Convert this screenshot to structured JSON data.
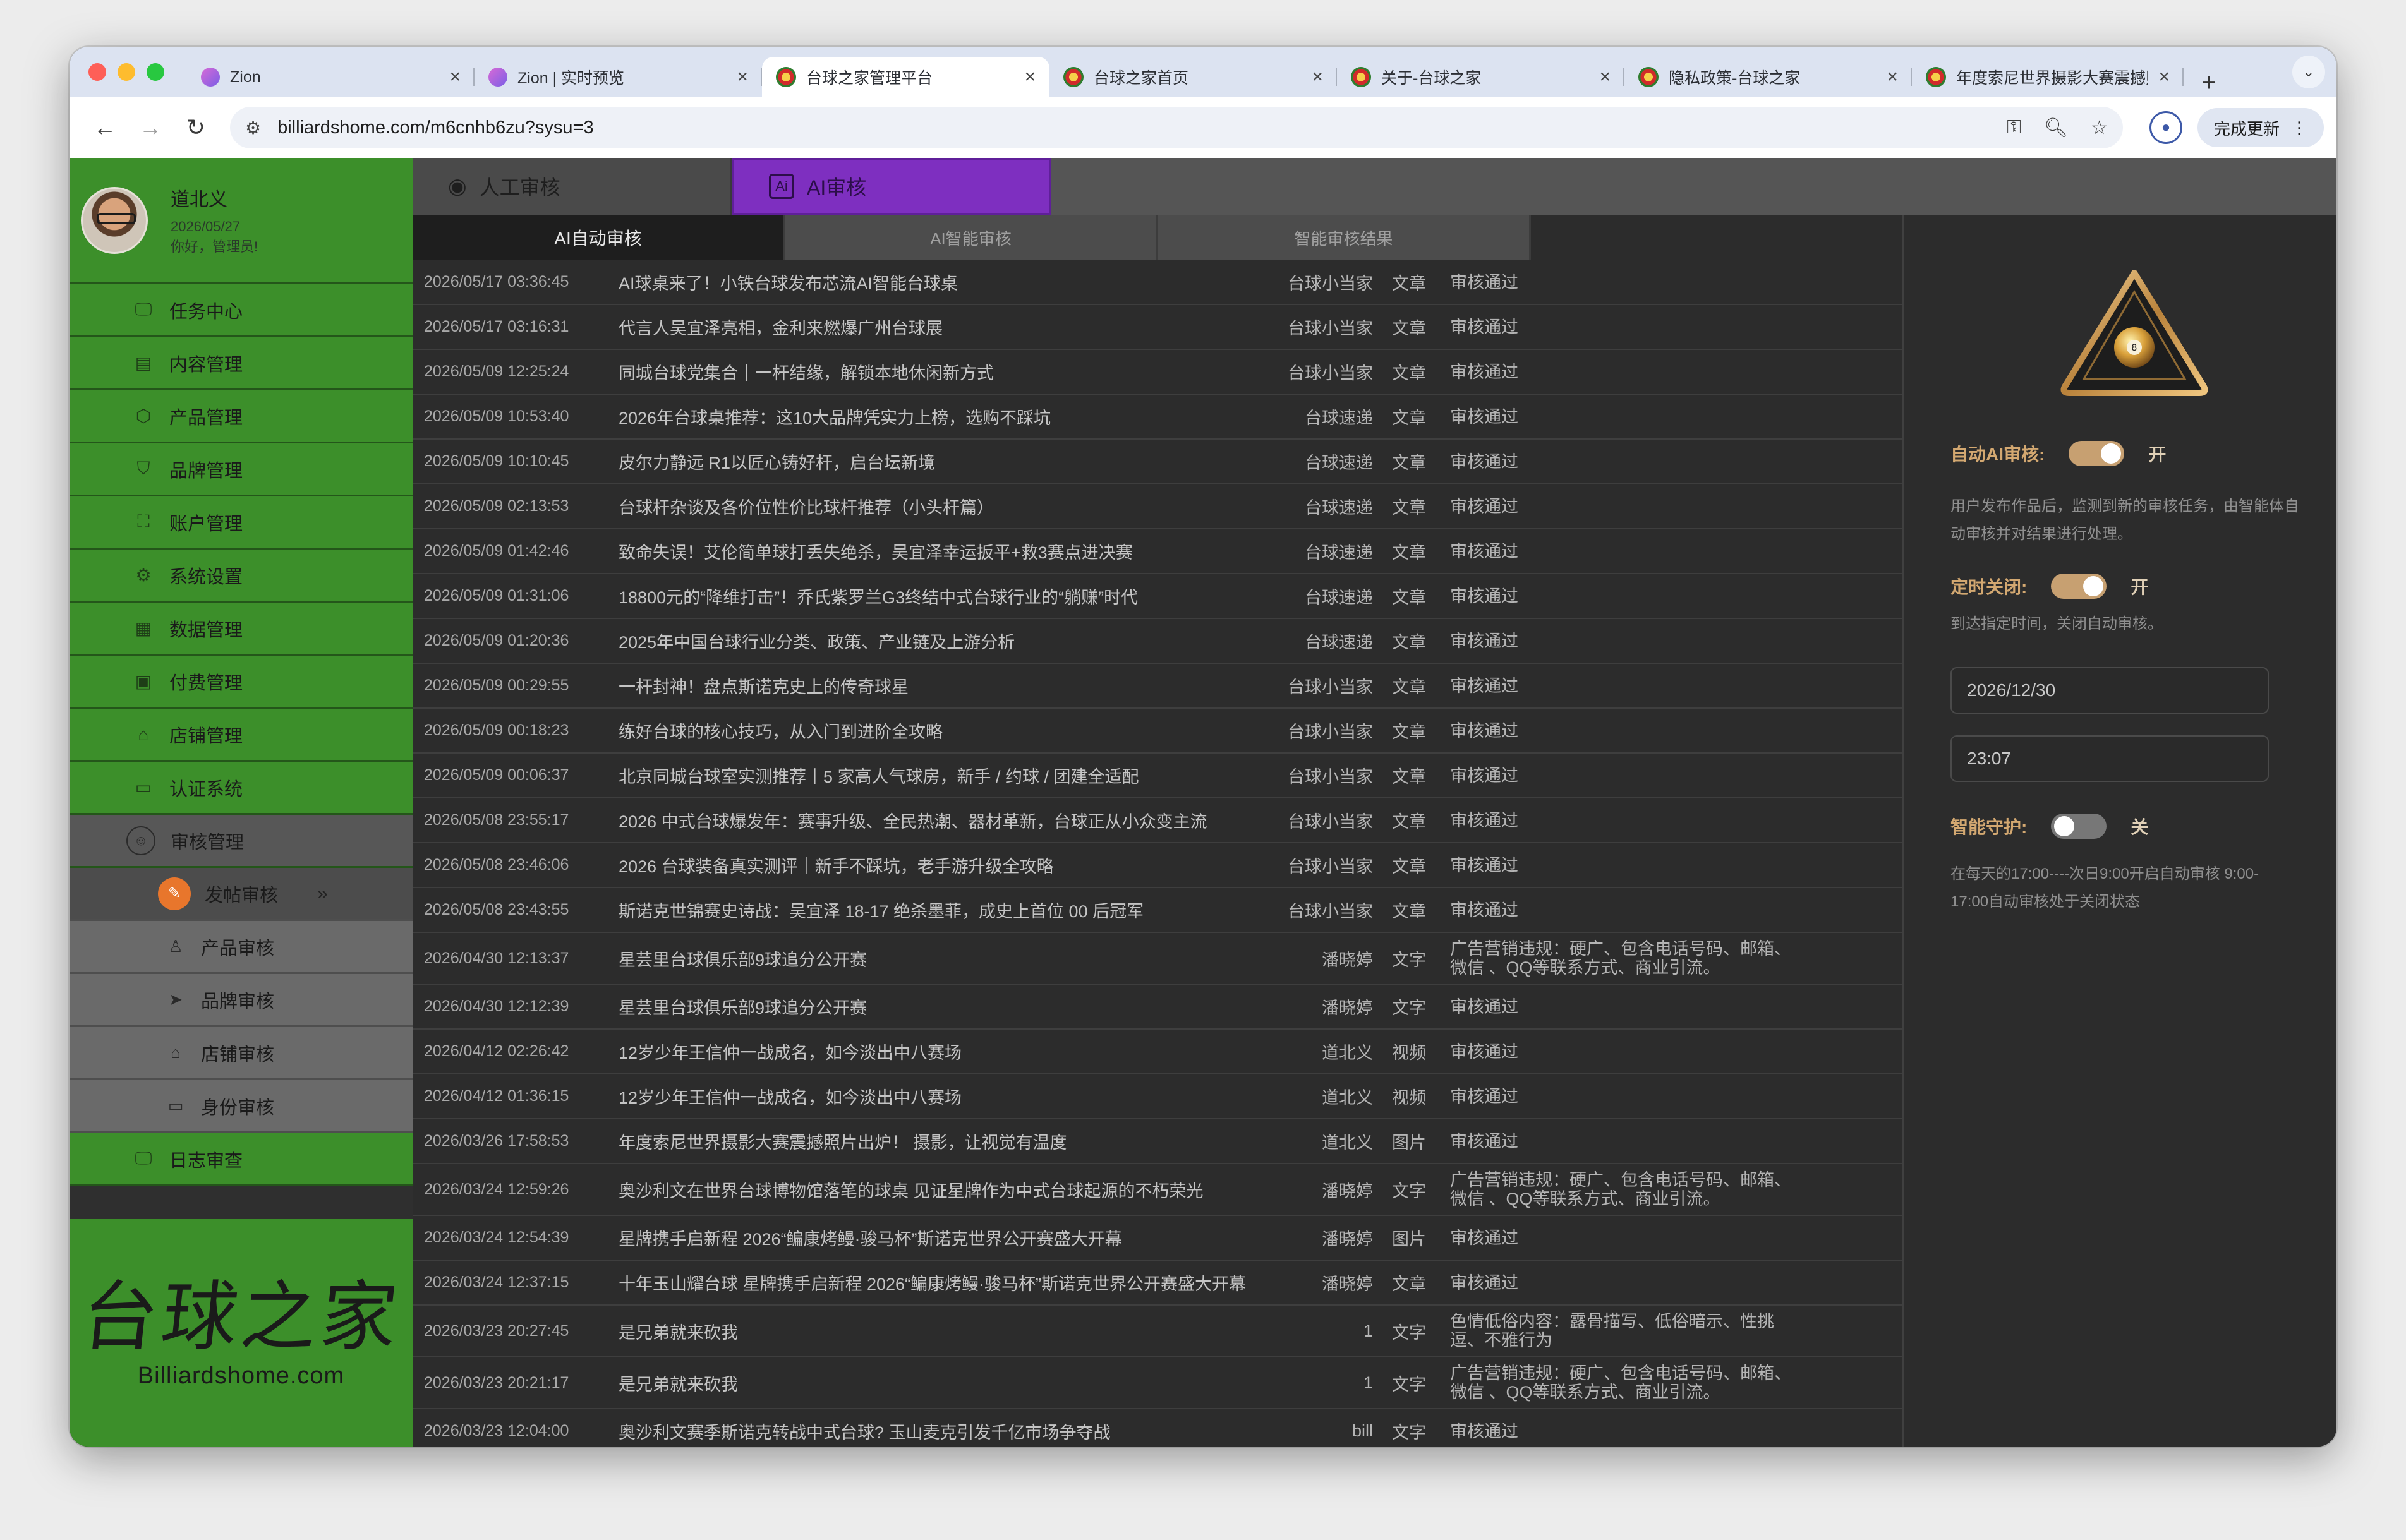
{
  "browser": {
    "tabs": [
      {
        "title": "Zion",
        "favicon": "zion-icon",
        "active": false
      },
      {
        "title": "Zion | 实时预览",
        "favicon": "zion-icon",
        "active": false
      },
      {
        "title": "台球之家管理平台",
        "favicon": "billiards-ball-icon",
        "active": true
      },
      {
        "title": "台球之家首页",
        "favicon": "billiards-ball-icon",
        "active": false
      },
      {
        "title": "关于-台球之家",
        "favicon": "billiards-ball-icon",
        "active": false
      },
      {
        "title": "隐私政策-台球之家",
        "favicon": "billiards-ball-icon",
        "active": false
      },
      {
        "title": "年度索尼世界摄影大赛震撼照",
        "favicon": "billiards-ball-icon",
        "active": false
      }
    ],
    "new_tab": "+",
    "url": "billiardshome.com/m6cnhb6zu?sysu=3",
    "update_label": "完成更新"
  },
  "user": {
    "name": "道北义",
    "date": "2026/05/27",
    "greeting": "你好，管理员!"
  },
  "menu": {
    "items": [
      {
        "label": "任务中心",
        "icon": "monitor-icon"
      },
      {
        "label": "内容管理",
        "icon": "document-icon"
      },
      {
        "label": "产品管理",
        "icon": "box-icon"
      },
      {
        "label": "品牌管理",
        "icon": "shield-icon"
      },
      {
        "label": "账户管理",
        "icon": "account-icon"
      },
      {
        "label": "系统设置",
        "icon": "gear-icon"
      },
      {
        "label": "数据管理",
        "icon": "data-icon"
      },
      {
        "label": "付费管理",
        "icon": "payment-icon"
      },
      {
        "label": "店铺管理",
        "icon": "store-icon"
      },
      {
        "label": "认证系统",
        "icon": "id-card-icon"
      }
    ],
    "review": {
      "label": "审核管理",
      "icon": "review-icon",
      "subitems": [
        {
          "label": "发帖审核",
          "icon": "post-review-icon",
          "active": true,
          "arrow": "»"
        },
        {
          "label": "产品审核",
          "icon": "product-review-icon"
        },
        {
          "label": "品牌审核",
          "icon": "brand-review-icon"
        },
        {
          "label": "店铺审核",
          "icon": "store-review-icon"
        },
        {
          "label": "身份审核",
          "icon": "identity-review-icon"
        }
      ]
    },
    "log": {
      "label": "日志审查",
      "icon": "log-icon"
    }
  },
  "logo": {
    "mark": "台球之家",
    "text": "Billiardshome.com"
  },
  "top_tabs": {
    "manual": "人工审核",
    "ai": "AI审核"
  },
  "sub_tabs": [
    "AI自动审核",
    "AI智能审核",
    "智能审核结果"
  ],
  "rows": [
    {
      "date": "2026/05/17 03:36:45",
      "title": "AI球桌来了！小铁台球发布芯流AI智能台球桌",
      "author": "台球小当家",
      "type": "文章",
      "status": "审核通过"
    },
    {
      "date": "2026/05/17 03:16:31",
      "title": "代言人吴宜泽亮相，金利来燃爆广州台球展",
      "author": "台球小当家",
      "type": "文章",
      "status": "审核通过"
    },
    {
      "date": "2026/05/09 12:25:24",
      "title": "同城台球党集合｜一杆结缘，解锁本地休闲新方式",
      "author": "台球小当家",
      "type": "文章",
      "status": "审核通过"
    },
    {
      "date": "2026/05/09 10:53:40",
      "title": "2026年台球桌推荐：这10大品牌凭实力上榜，选购不踩坑",
      "author": "台球速递",
      "type": "文章",
      "status": "审核通过"
    },
    {
      "date": "2026/05/09 10:10:45",
      "title": "皮尔力静远 R1以匠心铸好杆，启台坛新境",
      "author": "台球速递",
      "type": "文章",
      "status": "审核通过"
    },
    {
      "date": "2026/05/09 02:13:53",
      "title": "台球杆杂谈及各价位性价比球杆推荐（小头杆篇）",
      "author": "台球速递",
      "type": "文章",
      "status": "审核通过"
    },
    {
      "date": "2026/05/09 01:42:46",
      "title": "致命失误！艾伦简单球打丢失绝杀，吴宜泽幸运扳平+救3赛点进决赛",
      "author": "台球速递",
      "type": "文章",
      "status": "审核通过"
    },
    {
      "date": "2026/05/09 01:31:06",
      "title": "18800元的“降维打击”！乔氏紫罗兰G3终结中式台球行业的“躺赚”时代",
      "author": "台球速递",
      "type": "文章",
      "status": "审核通过"
    },
    {
      "date": "2026/05/09 01:20:36",
      "title": "2025年中国台球行业分类、政策、产业链及上游分析",
      "author": "台球速递",
      "type": "文章",
      "status": "审核通过"
    },
    {
      "date": "2026/05/09 00:29:55",
      "title": "一杆封神！盘点斯诺克史上的传奇球星",
      "author": "台球小当家",
      "type": "文章",
      "status": "审核通过"
    },
    {
      "date": "2026/05/09 00:18:23",
      "title": "练好台球的核心技巧，从入门到进阶全攻略",
      "author": "台球小当家",
      "type": "文章",
      "status": "审核通过"
    },
    {
      "date": "2026/05/09 00:06:37",
      "title": "北京同城台球室实测推荐丨5 家高人气球房，新手 / 约球 / 团建全适配",
      "author": "台球小当家",
      "type": "文章",
      "status": "审核通过"
    },
    {
      "date": "2026/05/08 23:55:17",
      "title": "2026 中式台球爆发年：赛事升级、全民热潮、器材革新，台球正从小众变主流",
      "author": "台球小当家",
      "type": "文章",
      "status": "审核通过"
    },
    {
      "date": "2026/05/08 23:46:06",
      "title": "2026 台球装备真实测评｜新手不踩坑，老手游升级全攻略",
      "author": "台球小当家",
      "type": "文章",
      "status": "审核通过"
    },
    {
      "date": "2026/05/08 23:43:55",
      "title": "斯诺克世锦赛史诗战：吴宜泽 18-17 绝杀墨菲，成史上首位 00 后冠军",
      "author": "台球小当家",
      "type": "文章",
      "status": "审核通过"
    },
    {
      "date": "2026/04/30 12:13:37",
      "title": "星芸里台球俱乐部9球追分公开赛",
      "author": "潘晓婷",
      "type": "文字",
      "status": "广告营销违规：硬广、包含电话号码、邮箱、微信 、QQ等联系方式、商业引流。",
      "tall": true
    },
    {
      "date": "2026/04/30 12:12:39",
      "title": "星芸里台球俱乐部9球追分公开赛",
      "author": "潘晓婷",
      "type": "文字",
      "status": "审核通过"
    },
    {
      "date": "2026/04/12 02:26:42",
      "title": "12岁少年王信仲一战成名，如今淡出中八赛场",
      "author": "道北义",
      "type": "视频",
      "status": "审核通过"
    },
    {
      "date": "2026/04/12 01:36:15",
      "title": "12岁少年王信仲一战成名，如今淡出中八赛场",
      "author": "道北义",
      "type": "视频",
      "status": "审核通过"
    },
    {
      "date": "2026/03/26 17:58:53",
      "title": "年度索尼世界摄影大赛震撼照片出炉！ 摄影，让视觉有温度",
      "author": "道北义",
      "type": "图片",
      "status": "审核通过"
    },
    {
      "date": "2026/03/24 12:59:26",
      "title": "奥沙利文在世界台球博物馆落笔的球桌 见证星牌作为中式台球起源的不朽荣光",
      "author": "潘晓婷",
      "type": "文字",
      "status": "广告营销违规：硬广、包含电话号码、邮箱、微信 、QQ等联系方式、商业引流。",
      "tall": true
    },
    {
      "date": "2026/03/24 12:54:39",
      "title": "星牌携手启新程 2026“鳊康烤鳗·骏马杯”斯诺克世界公开赛盛大开幕",
      "author": "潘晓婷",
      "type": "图片",
      "status": "审核通过"
    },
    {
      "date": "2026/03/24 12:37:15",
      "title": "十年玉山耀台球 星牌携手启新程 2026“鳊康烤鳗·骏马杯”斯诺克世界公开赛盛大开幕",
      "author": "潘晓婷",
      "type": "文章",
      "status": "审核通过"
    },
    {
      "date": "2026/03/23 20:27:45",
      "title": "是兄弟就来砍我",
      "author": "1",
      "type": "文字",
      "status": "色情低俗内容：露骨描写、低俗暗示、性挑逗、不雅行为",
      "tall": true
    },
    {
      "date": "2026/03/23 20:21:17",
      "title": "是兄弟就来砍我",
      "author": "1",
      "type": "文字",
      "status": "广告营销违规：硬广、包含电话号码、邮箱、微信 、QQ等联系方式、商业引流。",
      "tall": true
    },
    {
      "date": "2026/03/23 12:04:00",
      "title": "奥沙利文赛季斯诺克转战中式台球? 玉山麦克引发千亿市场争夺战",
      "author": "bill",
      "type": "文字",
      "status": "审核通过"
    }
  ],
  "settings": {
    "auto_ai": {
      "label": "自动AI审核:",
      "state": "开",
      "on": true
    },
    "auto_ai_desc": "用户发布作品后，监测到新的审核任务，由智能体自动审核并对结果进行处理。",
    "timed_close": {
      "label": "定时关闭:",
      "state": "开",
      "on": true
    },
    "timed_close_desc": "到达指定时间，关闭自动审核。",
    "date_value": "2026/12/30",
    "time_value": "23:07",
    "smart_guard": {
      "label": "智能守护:",
      "state": "关",
      "on": false
    },
    "smart_guard_desc": "在每天的17:00----次日9:00开启自动审核 9:00-17:00自动审核处于关闭状态"
  },
  "colors": {
    "sidebar_green": "#3c8f2a",
    "ai_tab_purple": "#7e2fc0",
    "toggle_on": "#c7a071",
    "active_badge": "#e8762c"
  }
}
